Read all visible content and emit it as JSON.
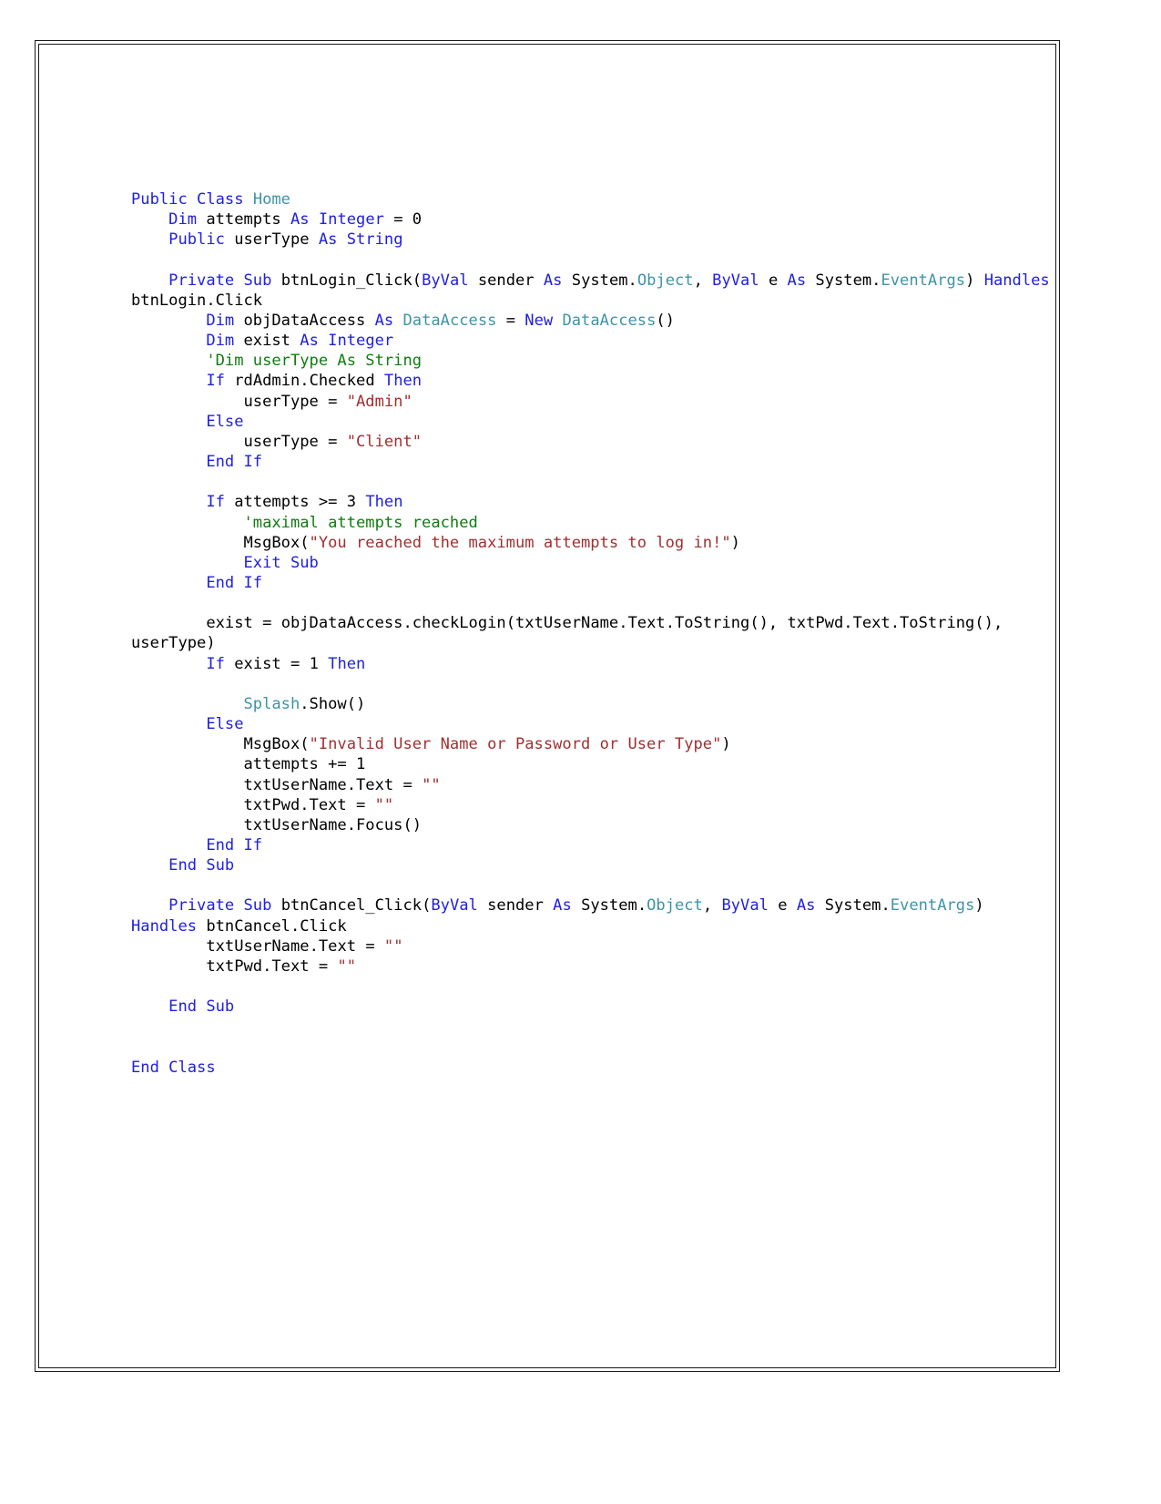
{
  "document": {
    "kind": "source-code-listing",
    "language": "Visual Basic .NET",
    "class_name": "Home",
    "page_background": "#ffffff",
    "sheet_border_color": "#1a1a1a"
  },
  "colors": {
    "keyword": "#2020E0",
    "type": "#3E93A8",
    "string": "#A03030",
    "comment": "#107C10",
    "plain": "#000000"
  },
  "code": {
    "lines": [
      {
        "id": "l01",
        "text": "Public Class Home"
      },
      {
        "id": "l02",
        "text": "    Dim attempts As Integer = 0"
      },
      {
        "id": "l03",
        "text": "    Public userType As String"
      },
      {
        "id": "l04",
        "text": ""
      },
      {
        "id": "l05",
        "text": "    Private Sub btnLogin_Click(ByVal sender As System.Object, ByVal e As System.EventArgs) Handles btnLogin.Click"
      },
      {
        "id": "l06",
        "text": "        Dim objDataAccess As DataAccess = New DataAccess()"
      },
      {
        "id": "l07",
        "text": "        Dim exist As Integer"
      },
      {
        "id": "l08",
        "text": "        'Dim userType As String"
      },
      {
        "id": "l09",
        "text": "        If rdAdmin.Checked Then"
      },
      {
        "id": "l10",
        "text": "            userType = \"Admin\""
      },
      {
        "id": "l11",
        "text": "        Else"
      },
      {
        "id": "l12",
        "text": "            userType = \"Client\""
      },
      {
        "id": "l13",
        "text": "        End If"
      },
      {
        "id": "l14",
        "text": ""
      },
      {
        "id": "l15",
        "text": "        If attempts >= 3 Then"
      },
      {
        "id": "l16",
        "text": "            'maximal attempts reached"
      },
      {
        "id": "l17",
        "text": "            MsgBox(\"You reached the maximum attempts to log in!\")"
      },
      {
        "id": "l18",
        "text": "            Exit Sub"
      },
      {
        "id": "l19",
        "text": "        End If"
      },
      {
        "id": "l20",
        "text": ""
      },
      {
        "id": "l21",
        "text": "        exist = objDataAccess.checkLogin(txtUserName.Text.ToString(), txtPwd.Text.ToString(), userType)"
      },
      {
        "id": "l22",
        "text": "        If exist = 1 Then"
      },
      {
        "id": "l23",
        "text": ""
      },
      {
        "id": "l24",
        "text": "            Splash.Show()"
      },
      {
        "id": "l25",
        "text": "        Else"
      },
      {
        "id": "l26",
        "text": "            MsgBox(\"Invalid User Name or Password or User Type\")"
      },
      {
        "id": "l27",
        "text": "            attempts += 1"
      },
      {
        "id": "l28",
        "text": "            txtUserName.Text = \"\""
      },
      {
        "id": "l29",
        "text": "            txtPwd.Text = \"\""
      },
      {
        "id": "l30",
        "text": "            txtUserName.Focus()"
      },
      {
        "id": "l31",
        "text": "        End If"
      },
      {
        "id": "l32",
        "text": "    End Sub"
      },
      {
        "id": "l33",
        "text": ""
      },
      {
        "id": "l34",
        "text": "    Private Sub btnCancel_Click(ByVal sender As System.Object, ByVal e As System.EventArgs) Handles btnCancel.Click"
      },
      {
        "id": "l35",
        "text": "        txtUserName.Text = \"\""
      },
      {
        "id": "l36",
        "text": "        txtPwd.Text = \"\""
      },
      {
        "id": "l37",
        "text": ""
      },
      {
        "id": "l38",
        "text": "    End Sub"
      },
      {
        "id": "l39",
        "text": ""
      },
      {
        "id": "l40",
        "text": ""
      },
      {
        "id": "l41",
        "text": "End Class"
      }
    ],
    "keywords": [
      "Public",
      "Class",
      "Dim",
      "As",
      "Integer",
      "String",
      "Private",
      "Sub",
      "ByVal",
      "Handles",
      "New",
      "If",
      "Then",
      "Else",
      "End",
      "Exit"
    ],
    "types": [
      "Home",
      "Object",
      "EventArgs",
      "DataAccess",
      "Splash"
    ],
    "identifiers": [
      "attempts",
      "userType",
      "btnLogin_Click",
      "sender",
      "e",
      "System",
      "btnLogin",
      "Click",
      "objDataAccess",
      "exist",
      "rdAdmin",
      "Checked",
      "MsgBox",
      "checkLogin",
      "txtUserName",
      "Text",
      "ToString",
      "txtPwd",
      "Show",
      "Focus",
      "btnCancel_Click",
      "btnCancel"
    ],
    "strings": [
      "\"Admin\"",
      "\"Client\"",
      "\"You reached the maximum attempts to log in!\"",
      "\"Invalid User Name or Password or User Type\"",
      "\"\""
    ],
    "comments": [
      "'Dim userType As String",
      "'maximal attempts reached"
    ]
  }
}
